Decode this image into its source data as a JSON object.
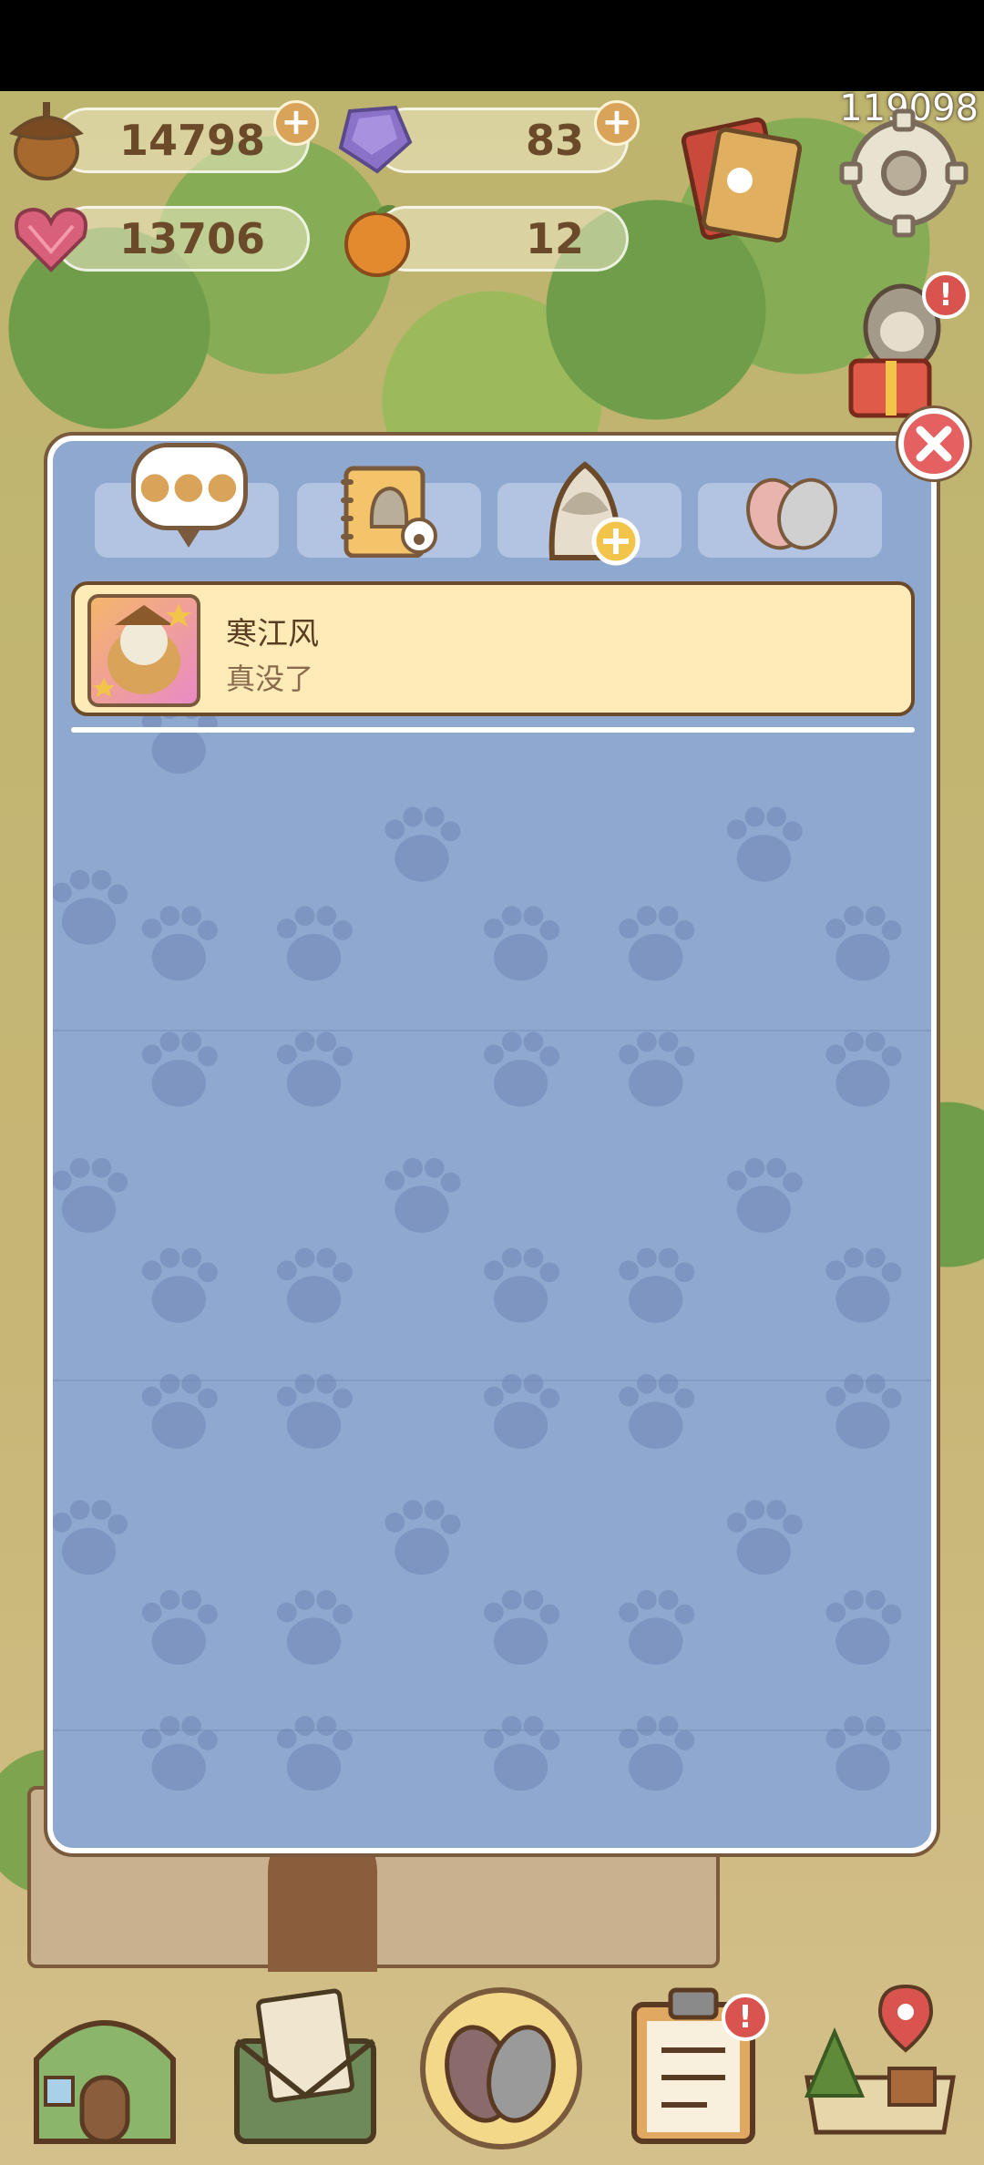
{
  "resources": {
    "acorn": "14798",
    "gem": "83",
    "heart": "13706",
    "orange": "12"
  },
  "player_id": "119098",
  "dialog": {
    "tabs": [
      {
        "name": "messages",
        "active": true
      },
      {
        "name": "friend-book"
      },
      {
        "name": "add-friend"
      },
      {
        "name": "paws"
      }
    ],
    "messages": [
      {
        "name": "寒江风",
        "text": "真没了"
      }
    ]
  },
  "bottom_nav": [
    "house",
    "mail",
    "paws",
    "tasks",
    "map"
  ],
  "colors": {
    "panel": "#8fa8cf",
    "message_bg": "#ffebb8",
    "accent": "#d9a35a",
    "close": "#e56060"
  }
}
